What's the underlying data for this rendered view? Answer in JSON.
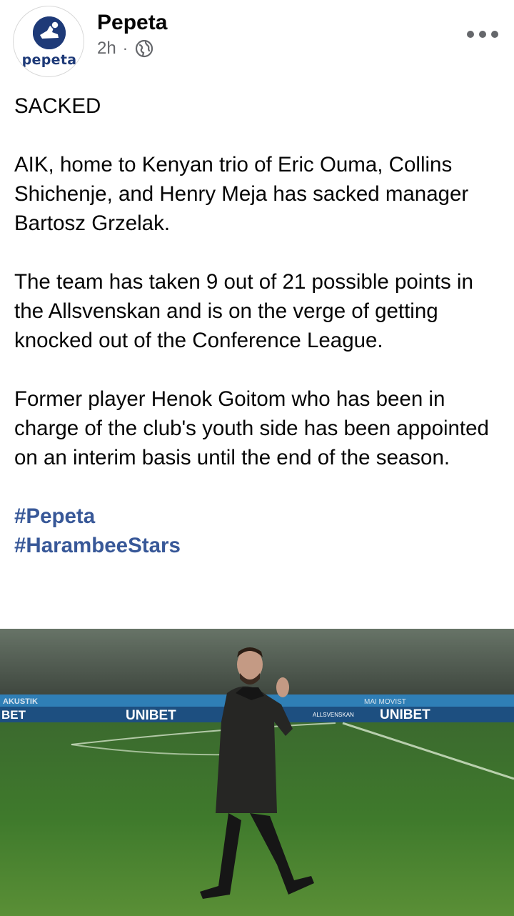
{
  "post": {
    "page_name": "Pepeta",
    "avatar_text": "pepeta",
    "time": "2h",
    "meta_separator": "·",
    "visibility_icon": "globe-icon",
    "more_icon": "more-options-icon",
    "paragraphs": [
      "SACKED",
      "AIK, home to Kenyan trio of Eric Ouma, Collins Shichenje, and Henry Meja has sacked manager Bartosz Grzelak.",
      "The team has taken 9 out of 21 possible points in the Allsvenskan and is on the verge of getting knocked out of the Conference League.",
      "Former player Henok Goitom who has been in charge of the club's youth side has been appointed on an interim basis until the end of the season."
    ],
    "hashtags": [
      "#Pepeta",
      "#HarambeeStars"
    ]
  },
  "photo": {
    "board_left_1": "AKUSTIK",
    "board_left_2": "BET",
    "board_unibet_1": "UNIBET",
    "board_unibet_2": "UNIBET",
    "board_allsvenskan": "ALLSVENSKAN",
    "board_top_right": "MAI MOVIST"
  },
  "colors": {
    "text": "#050505",
    "meta": "#65676b",
    "hashtag": "#385898",
    "avatar_brand": "#1e3a78"
  }
}
